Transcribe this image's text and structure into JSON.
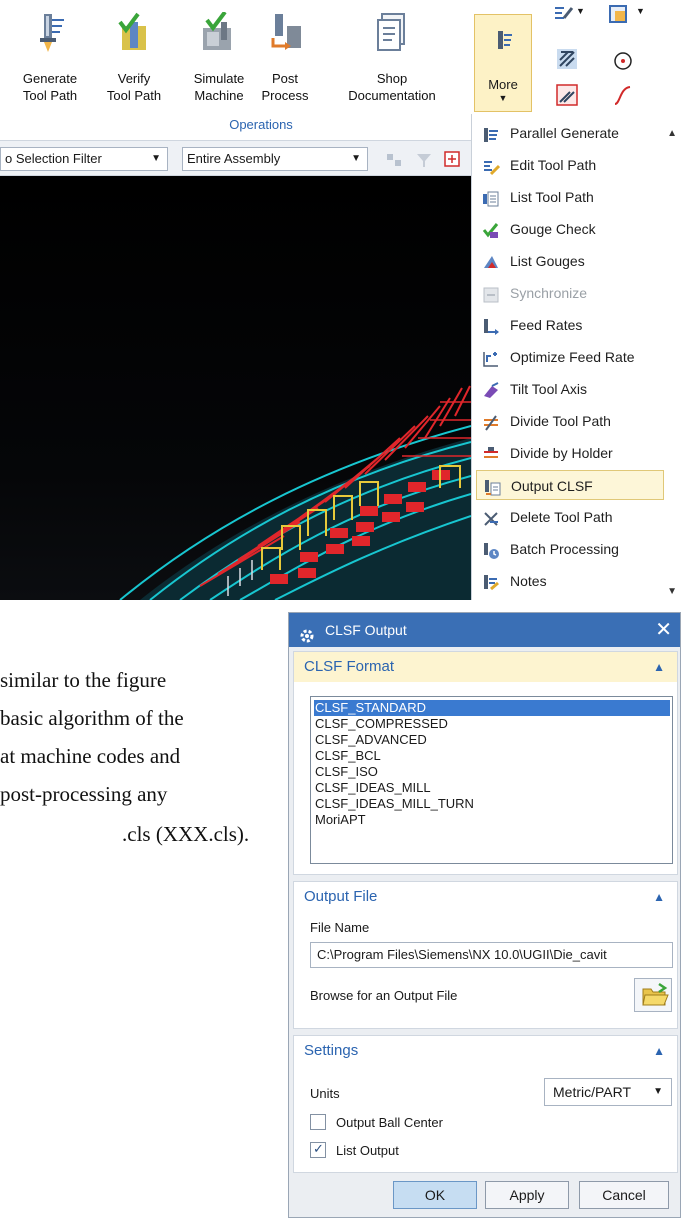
{
  "ribbon": {
    "buttons": [
      {
        "line1": "Generate",
        "line2": "Tool Path",
        "icon": "generate-tool-path-icon"
      },
      {
        "line1": "Verify",
        "line2": "Tool Path",
        "icon": "verify-tool-path-icon"
      },
      {
        "line1": "Simulate",
        "line2": "Machine",
        "icon": "simulate-machine-icon"
      },
      {
        "line1": "Post",
        "line2": "Process",
        "icon": "post-process-icon"
      },
      {
        "line1": "Shop",
        "line2": "Documentation",
        "icon": "shop-documentation-icon"
      }
    ],
    "group_label": "Operations",
    "more_label": "More"
  },
  "toolbar": {
    "selection_filter": "o Selection Filter",
    "assembly_scope": "Entire Assembly"
  },
  "more_menu": {
    "items": [
      {
        "label": "Parallel Generate",
        "icon": "parallel-generate-icon",
        "enabled": true,
        "highlighted": false
      },
      {
        "label": "Edit Tool Path",
        "icon": "edit-tool-path-icon",
        "enabled": true,
        "highlighted": false
      },
      {
        "label": "List Tool Path",
        "icon": "list-tool-path-icon",
        "enabled": true,
        "highlighted": false
      },
      {
        "label": "Gouge Check",
        "icon": "gouge-check-icon",
        "enabled": true,
        "highlighted": false
      },
      {
        "label": "List Gouges",
        "icon": "list-gouges-icon",
        "enabled": true,
        "highlighted": false
      },
      {
        "label": "Synchronize",
        "icon": "synchronize-icon",
        "enabled": false,
        "highlighted": false
      },
      {
        "label": "Feed Rates",
        "icon": "feed-rates-icon",
        "enabled": true,
        "highlighted": false
      },
      {
        "label": "Optimize Feed Rate",
        "icon": "optimize-feed-rate-icon",
        "enabled": true,
        "highlighted": false
      },
      {
        "label": "Tilt Tool Axis",
        "icon": "tilt-tool-axis-icon",
        "enabled": true,
        "highlighted": false
      },
      {
        "label": "Divide Tool Path",
        "icon": "divide-tool-path-icon",
        "enabled": true,
        "highlighted": false
      },
      {
        "label": "Divide by Holder",
        "icon": "divide-by-holder-icon",
        "enabled": true,
        "highlighted": false
      },
      {
        "label": "Output CLSF",
        "icon": "output-clsf-icon",
        "enabled": true,
        "highlighted": true
      },
      {
        "label": "Delete Tool Path",
        "icon": "delete-tool-path-icon",
        "enabled": true,
        "highlighted": false
      },
      {
        "label": "Batch Processing",
        "icon": "batch-processing-icon",
        "enabled": true,
        "highlighted": false
      },
      {
        "label": "Notes",
        "icon": "notes-icon",
        "enabled": true,
        "highlighted": false
      }
    ]
  },
  "body_text": {
    "line1": "similar to the figure",
    "line2": "basic algorithm of the",
    "line3": "at machine codes and",
    "line4": "post-processing any",
    "line5": ".cls (XXX.cls)."
  },
  "dialog": {
    "title": "CLSF Output",
    "format_section": {
      "title": "CLSF Format",
      "options": [
        "CLSF_STANDARD",
        "CLSF_COMPRESSED",
        "CLSF_ADVANCED",
        "CLSF_BCL",
        "CLSF_ISO",
        "CLSF_IDEAS_MILL",
        "CLSF_IDEAS_MILL_TURN",
        "MoriAPT"
      ],
      "selected": "CLSF_STANDARD"
    },
    "output_section": {
      "title": "Output File",
      "file_name_label": "File Name",
      "file_name_value": "C:\\Program Files\\Siemens\\NX 10.0\\UGII\\Die_cavit",
      "browse_label": "Browse for an Output File"
    },
    "settings_section": {
      "title": "Settings",
      "units_label": "Units",
      "units_value": "Metric/PART",
      "ball_center_label": "Output Ball Center",
      "ball_center_checked": false,
      "list_output_label": "List Output",
      "list_output_checked": true
    },
    "buttons": {
      "ok": "OK",
      "apply": "Apply",
      "cancel": "Cancel"
    }
  },
  "colors": {
    "accent_blue": "#2b64b0",
    "title_bar": "#3a6fb5",
    "highlight": "#fdf6d8",
    "selection": "#3a7ad0"
  }
}
